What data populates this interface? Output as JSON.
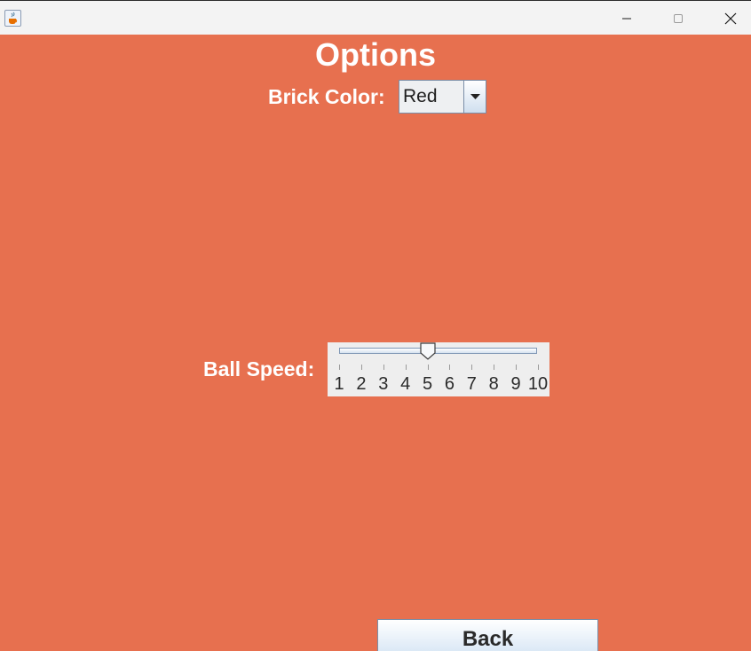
{
  "window": {
    "app_icon": "java-cup-icon",
    "controls": [
      "minimize-icon",
      "maximize-icon",
      "close-icon"
    ]
  },
  "page": {
    "title": "Options",
    "background_color": "#e7704f"
  },
  "brick_color": {
    "label": "Brick Color:",
    "selected": "Red"
  },
  "ball_speed": {
    "label": "Ball Speed:",
    "min": 1,
    "max": 10,
    "value": 5,
    "tick_labels": [
      "1",
      "2",
      "3",
      "4",
      "5",
      "6",
      "7",
      "8",
      "9",
      "10"
    ]
  },
  "back_button": {
    "label": "Back"
  }
}
